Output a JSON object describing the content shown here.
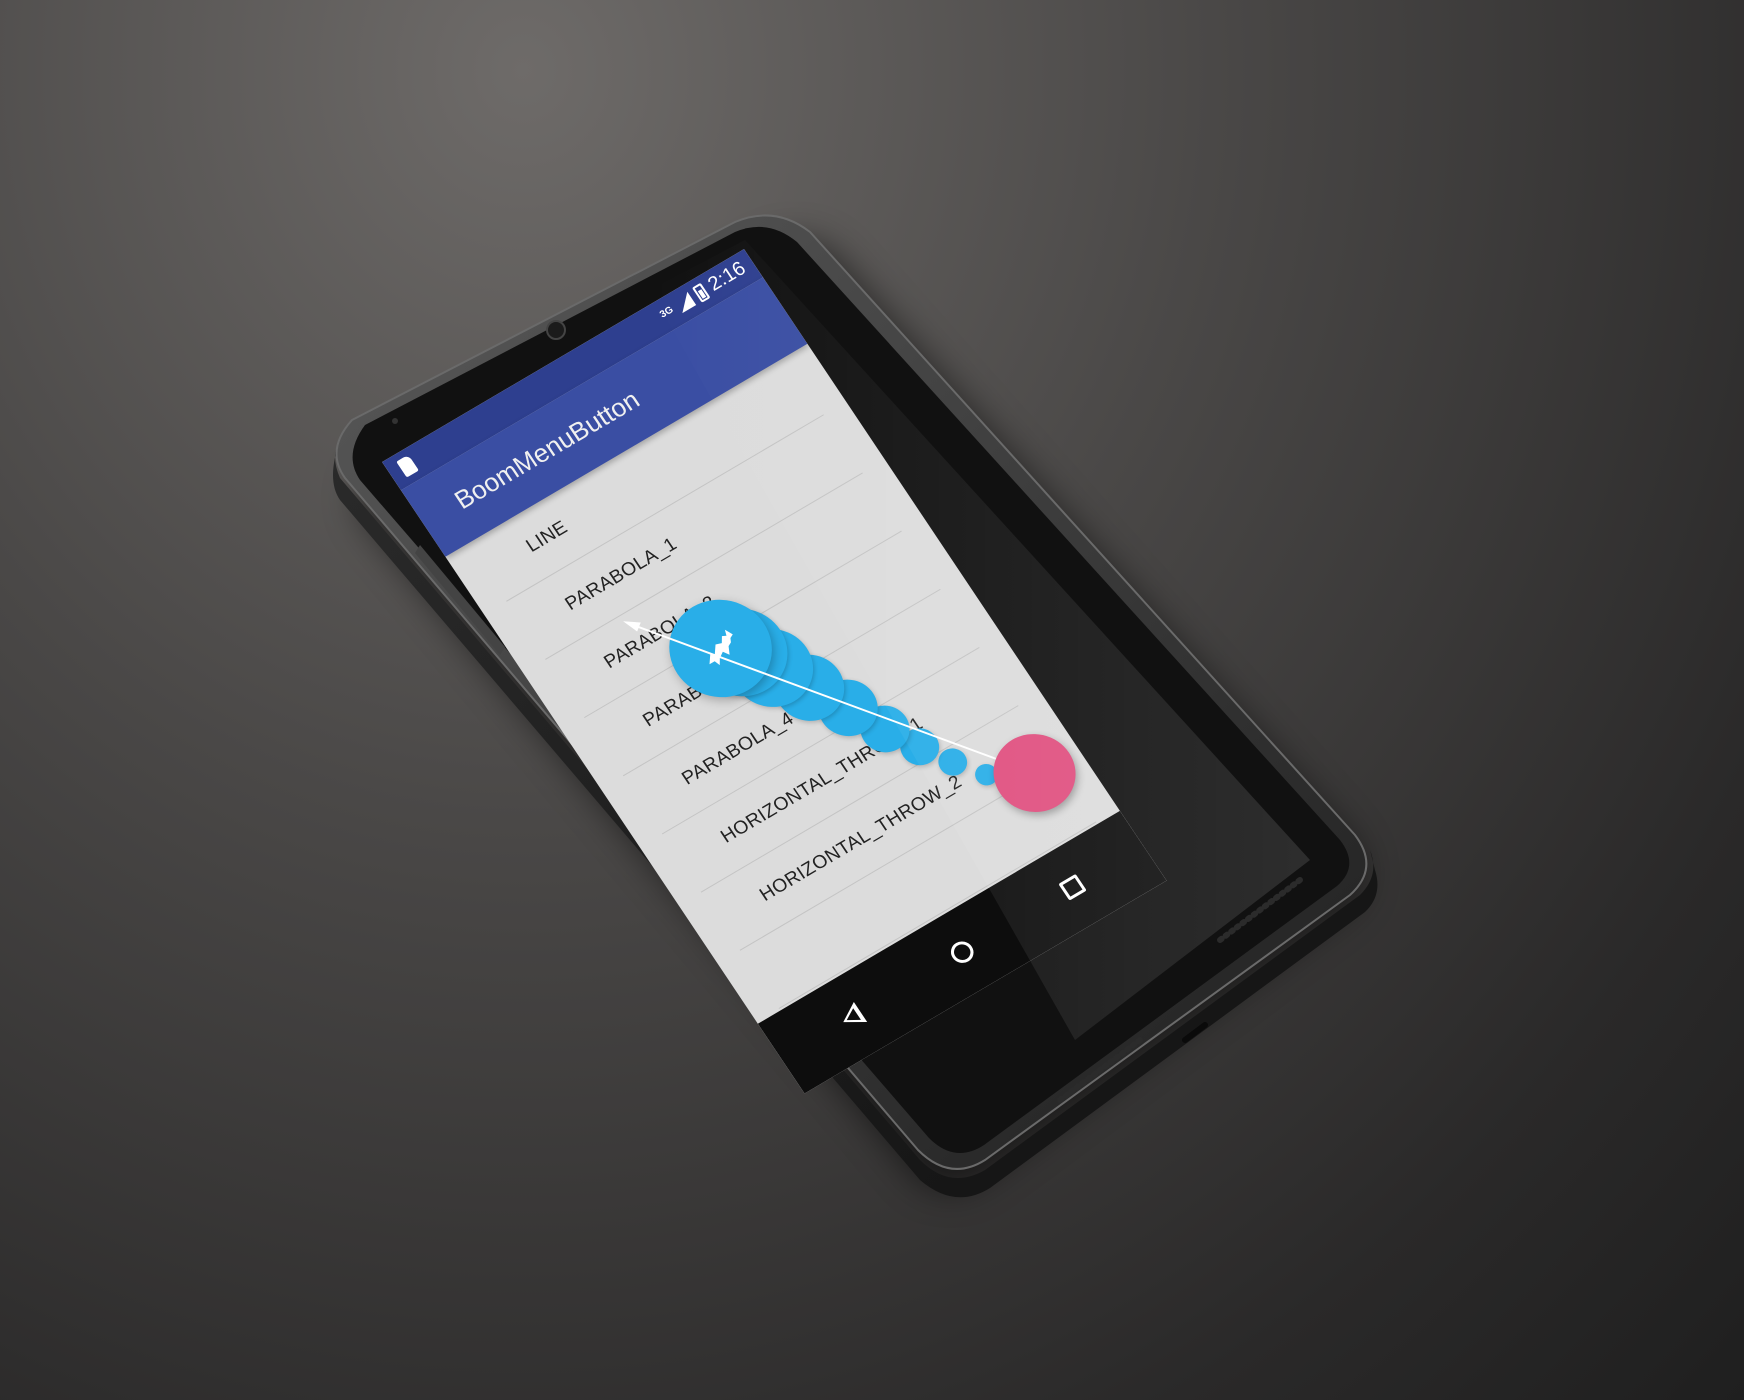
{
  "status_bar": {
    "network": "3G",
    "time": "2:16",
    "sd_icon": "sd-card-icon",
    "signal_icon": "signal-icon",
    "battery_icon": "battery-icon"
  },
  "app_bar": {
    "title": "BoomMenuButton"
  },
  "list": {
    "items": [
      {
        "label": "LINE"
      },
      {
        "label": "PARABOLA_1"
      },
      {
        "label": "PARABOLA_2"
      },
      {
        "label": "PARABOLA_3"
      },
      {
        "label": "PARABOLA_4"
      },
      {
        "label": "HORIZONTAL_THROW_1"
      },
      {
        "label": "HORIZONTAL_THROW_2"
      },
      {
        "label": ""
      }
    ]
  },
  "boom_menu": {
    "button_color": "#e04f7f",
    "boom_color": "#29aee8",
    "lead_icon": "horse-icon"
  },
  "nav_bar": {
    "back_icon": "back-icon",
    "home_icon": "home-icon",
    "recent_icon": "recent-apps-icon"
  },
  "colors": {
    "primary": "#3a4ea3",
    "primary_dark": "#2e3f8f",
    "list_bg": "#dcdcdc",
    "accent": "#e04f7f"
  }
}
